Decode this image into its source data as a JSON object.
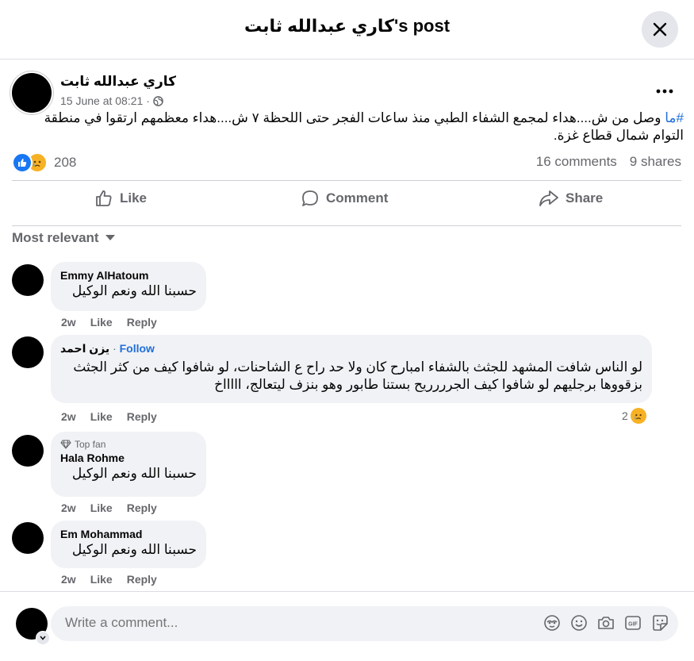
{
  "header": {
    "title": "كاري عبدالله ثابت's post"
  },
  "post": {
    "author": "كاري عبدالله ثابت",
    "timestamp": "15 June at 08:21 ·",
    "hashtag": "#ما",
    "text": " وصل من ش....هداء لمجمع الشفاء الطبي منذ ساعات الفجر حتى اللحظة ٧ ش....هداء معظمهم ارتقوا في منطقة التوام شمال قطاع غزة.",
    "reaction_count": "208",
    "comments_count": "16 comments",
    "shares_count": "9 shares"
  },
  "actions": {
    "like": "Like",
    "comment": "Comment",
    "share": "Share"
  },
  "sort_label": "Most relevant",
  "comments": [
    {
      "name": "Emmy AlHatoum",
      "text": "حسبنا الله ونعم الوكيل",
      "time": "2w",
      "like": "Like",
      "reply": "Reply"
    },
    {
      "name": "يزن احمد",
      "follow": "Follow",
      "separator": "·",
      "text": "لو الناس شافت المشهد للجثث بالشفاء امبارح كان ولا حد راح ع الشاحنات، لو شافوا كيف من كثر الجثث بزقووها برجليهم لو شافوا كيف الجرررريح بستنا طابور وهو بنزف ليتعالج، اااااخ",
      "time": "2w",
      "like": "Like",
      "reply": "Reply",
      "reaction_count": "2"
    },
    {
      "badge": "Top fan",
      "name": "Hala Rohme",
      "text": "حسبنا الله ونعم الوكيل",
      "time": "2w",
      "like": "Like",
      "reply": "Reply"
    },
    {
      "name": "Em Mohammad",
      "text": "حسبنا الله ونعم الوكيل",
      "time": "2w",
      "like": "Like",
      "reply": "Reply"
    }
  ],
  "composer": {
    "placeholder": "Write a comment..."
  }
}
